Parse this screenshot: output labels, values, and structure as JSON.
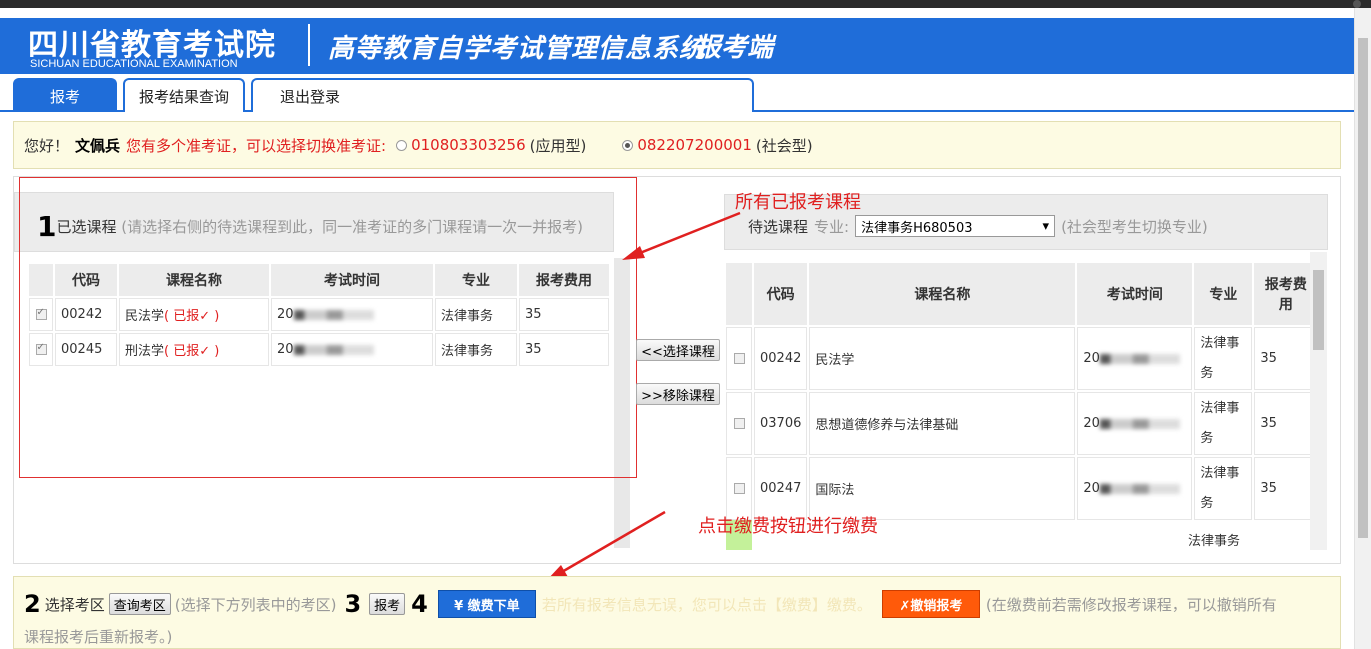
{
  "header": {
    "brand_cn": "四川省教育考试院",
    "brand_en": "SICHUAN EDUCATIONAL EXAMINATION",
    "system_title": "高等教育自学考试管理信息系统",
    "system_sub": "报考端"
  },
  "tabs": [
    {
      "label": "报考",
      "active": true
    },
    {
      "label": "报考结果查询",
      "active": false
    },
    {
      "label": "退出登录",
      "active": false
    }
  ],
  "greeting": {
    "hello": "您好！",
    "name": "文佩兵",
    "prompt": "您有多个准考证，可以选择切换准考证:",
    "tickets": [
      {
        "number": "010803303256",
        "type": "(应用型)",
        "selected": false
      },
      {
        "number": "082207200001",
        "type": "(社会型)",
        "selected": true
      }
    ]
  },
  "selected_courses": {
    "step": "1",
    "title": "已选课程",
    "hint": "(请选择右侧的待选课程到此，同一准考证的多门课程请一次一并报考)",
    "columns": [
      "代码",
      "课程名称",
      "考试时间",
      "专业",
      "报考费用"
    ],
    "rows": [
      {
        "code": "00242",
        "name": "民法学",
        "status": "( 已报✓ )",
        "time_prefix": "20",
        "major": "法律事务",
        "fee": "35"
      },
      {
        "code": "00245",
        "name": "刑法学",
        "status": "( 已报✓ )",
        "time_prefix": "20",
        "major": "法律事务",
        "fee": "35"
      }
    ]
  },
  "middle_buttons": {
    "select": "<<选择课程",
    "remove": ">>移除课程"
  },
  "pending_courses": {
    "title": "待选课程",
    "major_label": "专业:",
    "major_value": "法律事务H680503",
    "hint": "(社会型考生切换专业)",
    "columns": [
      "代码",
      "课程名称",
      "考试时间",
      "专业",
      "报考费用"
    ],
    "rows": [
      {
        "code": "00242",
        "name": "民法学",
        "time_prefix": "20",
        "major": "法律事务",
        "fee": "35"
      },
      {
        "code": "03706",
        "name": "思想道德修养与法律基础",
        "time_prefix": "20",
        "major": "法律事务",
        "fee": "35"
      },
      {
        "code": "00247",
        "name": "国际法",
        "time_prefix": "20",
        "major": "法律事务",
        "fee": "35"
      },
      {
        "code": "",
        "name": "",
        "time_prefix": "",
        "major": "法律事务",
        "fee": ""
      }
    ]
  },
  "annotations": {
    "all_registered": "所有已报考课程",
    "click_pay": "点击缴费按钮进行缴费"
  },
  "bottom": {
    "step2": "2",
    "select_area": "选择考区",
    "query_area_btn": "查询考区",
    "area_hint": "(选择下方列表中的考区)",
    "step3": "3",
    "register_btn": "报考",
    "step4": "4",
    "pay_btn": "¥ 缴费下单",
    "pay_hint": "若所有报考信息无误，您可以点击【缴费】缴费。",
    "cancel_btn": "✗撤销报考",
    "cancel_hint": "(在缴费前若需修改报考课程，可以撤销所有",
    "cancel_hint2": "课程报考后重新报考。)"
  }
}
